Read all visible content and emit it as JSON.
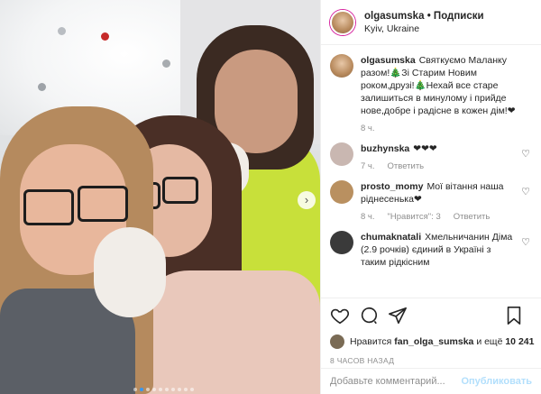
{
  "post": {
    "username": "olgasumska",
    "separator": "•",
    "follow_label": "Подписки",
    "location": "Kyiv, Ukraine"
  },
  "caption": {
    "username": "olgasumska",
    "text": "Святкуємо Маланку разом!🎄Зі Старим Новим роком,друзі!🎄Нехай все старе залишиться в минулому і прийде нове,добре і радісне в кожен дім!❤",
    "time": "8 ч."
  },
  "comments": [
    {
      "username": "buzhynska",
      "text": "❤❤❤",
      "time": "7 ч.",
      "reply_label": "Ответить",
      "likes": "",
      "avatar_color": "#c9b7b1"
    },
    {
      "username": "prosto_momy",
      "text": "Мої вітання наша ріднесенька❤",
      "time": "8 ч.",
      "reply_label": "Ответить",
      "likes": "\"Нравится\": 3",
      "avatar_color": "#b99060"
    },
    {
      "username": "chumaknatali",
      "text": "Хмельничанин Діма (2.9 рочків) єдиний в Україні з таким рідкісним",
      "time": "",
      "reply_label": "",
      "likes": "",
      "avatar_color": "#3a3a3a"
    }
  ],
  "icons": {
    "like": "heart-icon",
    "comment": "comment-icon",
    "share": "share-icon",
    "save": "bookmark-icon",
    "comment_like": "heart-outline-icon",
    "carousel_next": "chevron-right-icon"
  },
  "likes": {
    "prefix": "Нравится",
    "user": "fan_olga_sumska",
    "middle": "и ещё",
    "count": "10 241"
  },
  "date": "8 ЧАСОВ НАЗАД",
  "add_comment": {
    "placeholder": "Добавьте комментарий...",
    "publish_label": "Опубликовать"
  },
  "carousel": {
    "total": 10,
    "active": 1
  },
  "colors": {
    "publish_inactive": "#b2dffc",
    "muted": "#8e8e8e",
    "dot_active": "#3897f0"
  }
}
